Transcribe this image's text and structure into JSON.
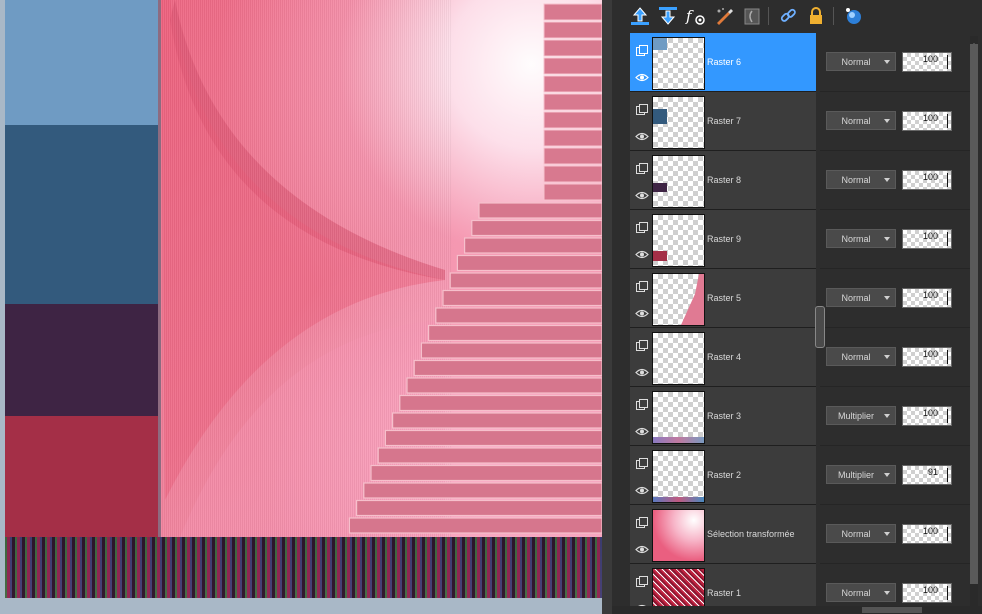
{
  "canvas": {
    "swatch_colors": [
      "#6f9bc3",
      "#335a7d",
      "#3e2444",
      "#a42f47"
    ],
    "background_color": "#f06f8a"
  },
  "toolbar": {
    "icons": [
      "move-layer-up-icon",
      "move-layer-down-icon",
      "layer-effects-icon",
      "edit-mask-icon",
      "mask-icon",
      "link-icon",
      "lock-icon",
      "layer-properties-icon"
    ]
  },
  "layers": [
    {
      "name": "Raster 6",
      "blend": "Normal",
      "opacity": "100",
      "selected": true,
      "thumb": "swatch-top"
    },
    {
      "name": "Raster 7",
      "blend": "Normal",
      "opacity": "100",
      "selected": false,
      "thumb": "swatch-mid"
    },
    {
      "name": "Raster 8",
      "blend": "Normal",
      "opacity": "100",
      "selected": false,
      "thumb": "swatch-low"
    },
    {
      "name": "Raster 9",
      "blend": "Normal",
      "opacity": "100",
      "selected": false,
      "thumb": "swatch-bottom"
    },
    {
      "name": "Raster 5",
      "blend": "Normal",
      "opacity": "100",
      "selected": false,
      "thumb": "stairs"
    },
    {
      "name": "Raster 4",
      "blend": "Normal",
      "opacity": "100",
      "selected": false,
      "thumb": "empty"
    },
    {
      "name": "Raster 3",
      "blend": "Multiplier",
      "opacity": "100",
      "selected": false,
      "thumb": "strip"
    },
    {
      "name": "Raster 2",
      "blend": "Multiplier",
      "opacity": "91",
      "selected": false,
      "thumb": "strip2"
    },
    {
      "name": "Sélection transformée",
      "blend": "Normal",
      "opacity": "100",
      "selected": false,
      "thumb": "pink"
    },
    {
      "name": "Raster 1",
      "blend": "Normal",
      "opacity": "100",
      "selected": false,
      "thumb": "texture"
    }
  ],
  "accent_color": "#3398ff"
}
